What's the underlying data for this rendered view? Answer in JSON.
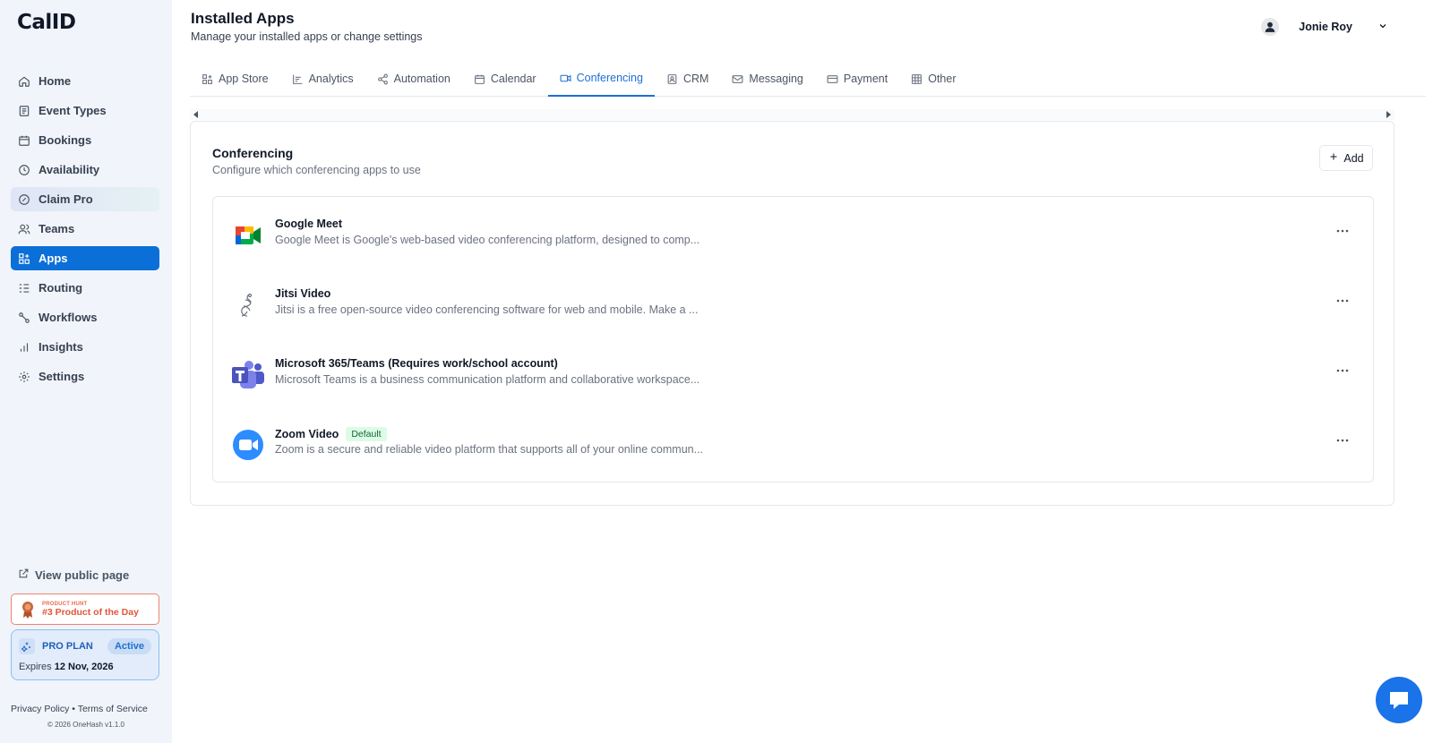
{
  "brand": {
    "logo": "CalID"
  },
  "sidebar": {
    "items": [
      {
        "label": "Home",
        "icon": "home-icon"
      },
      {
        "label": "Event Types",
        "icon": "event-types-icon"
      },
      {
        "label": "Bookings",
        "icon": "calendar-icon"
      },
      {
        "label": "Availability",
        "icon": "clock-icon"
      },
      {
        "label": "Claim Pro",
        "icon": "claim-pro-icon"
      },
      {
        "label": "Teams",
        "icon": "users-icon"
      },
      {
        "label": "Apps",
        "icon": "apps-icon",
        "active": true
      },
      {
        "label": "Routing",
        "icon": "routing-icon"
      },
      {
        "label": "Workflows",
        "icon": "workflow-icon"
      },
      {
        "label": "Insights",
        "icon": "bar-chart-icon"
      },
      {
        "label": "Settings",
        "icon": "gear-icon"
      }
    ],
    "view_public": "View public page",
    "product_hunt": {
      "small": "PRODUCT HUNT",
      "main": "#3 Product of the Day"
    },
    "pro_plan": {
      "label": "PRO PLAN",
      "status": "Active",
      "expires_label": "Expires",
      "expires_date": "12 Nov, 2026"
    },
    "footer": {
      "privacy": "Privacy Policy",
      "separator": "•",
      "terms": "Terms of Service",
      "copyright": "© 2026 OneHash v1.1.0"
    }
  },
  "header": {
    "title": "Installed Apps",
    "subtitle": "Manage your installed apps or change settings",
    "user_name": "Jonie Roy"
  },
  "tabs": [
    {
      "label": "App Store",
      "icon": "app-store-icon"
    },
    {
      "label": "Analytics",
      "icon": "analytics-icon"
    },
    {
      "label": "Automation",
      "icon": "share-icon"
    },
    {
      "label": "Calendar",
      "icon": "calendar-icon"
    },
    {
      "label": "Conferencing",
      "icon": "video-icon",
      "active": true
    },
    {
      "label": "CRM",
      "icon": "contact-icon"
    },
    {
      "label": "Messaging",
      "icon": "mail-icon"
    },
    {
      "label": "Payment",
      "icon": "credit-card-icon"
    },
    {
      "label": "Other",
      "icon": "grid-icon"
    }
  ],
  "section": {
    "title": "Conferencing",
    "subtitle": "Configure which conferencing apps to use",
    "add_label": "Add"
  },
  "apps": [
    {
      "name": "Google Meet",
      "description": "Google Meet is Google's web-based video conferencing platform, designed to comp...",
      "icon": "google-meet-icon"
    },
    {
      "name": "Jitsi Video",
      "description": "Jitsi is a free open-source video conferencing software for web and mobile. Make a ...",
      "icon": "jitsi-icon"
    },
    {
      "name": "Microsoft 365/Teams (Requires work/school account)",
      "description": "Microsoft Teams is a business communication platform and collaborative workspace...",
      "icon": "microsoft-teams-icon"
    },
    {
      "name": "Zoom Video",
      "badge": "Default",
      "description": "Zoom is a secure and reliable video platform that supports all of your online commun...",
      "icon": "zoom-icon"
    }
  ],
  "colors": {
    "accent": "#0b6fd8",
    "sidebar_bg": "#f1f4fb",
    "tab_active": "#1d6fd6"
  }
}
